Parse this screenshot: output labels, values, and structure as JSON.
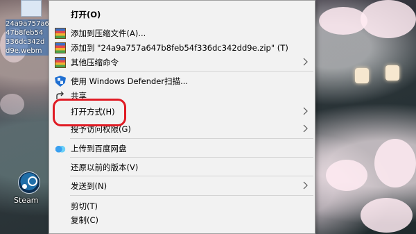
{
  "desktop": {
    "file": {
      "caption_lines": [
        "24a9a757a6",
        "47b8feb54",
        "336dc342d",
        "d9e.webm"
      ]
    },
    "steam": {
      "label": "Steam"
    }
  },
  "context_menu": {
    "items": [
      {
        "label": "打开(O)",
        "bold": true
      },
      {
        "label": "添加到压缩文件(A)...",
        "icon": "archive-icon"
      },
      {
        "label": "添加到 \"24a9a757a647b8feb54f336dc342dd9e.zip\" (T)",
        "icon": "archive-icon"
      },
      {
        "label": "其他压缩命令",
        "icon": "archive-icon",
        "submenu": true
      },
      {
        "label": "使用 Windows Defender扫描...",
        "icon": "shield-icon"
      },
      {
        "label": "共享",
        "icon": "share-icon"
      },
      {
        "label": "打开方式(H)",
        "submenu": true
      },
      {
        "label": "授予访问权限(G)",
        "submenu": true
      },
      {
        "label": "上传到百度网盘",
        "icon": "cloud-icon"
      },
      {
        "label": "还原以前的版本(V)"
      },
      {
        "label": "发送到(N)",
        "submenu": true
      },
      {
        "label": "剪切(T)"
      },
      {
        "label": "复制(C)"
      }
    ]
  },
  "annotation": {
    "color": "#e01b24",
    "target": "打开方式(H)"
  }
}
